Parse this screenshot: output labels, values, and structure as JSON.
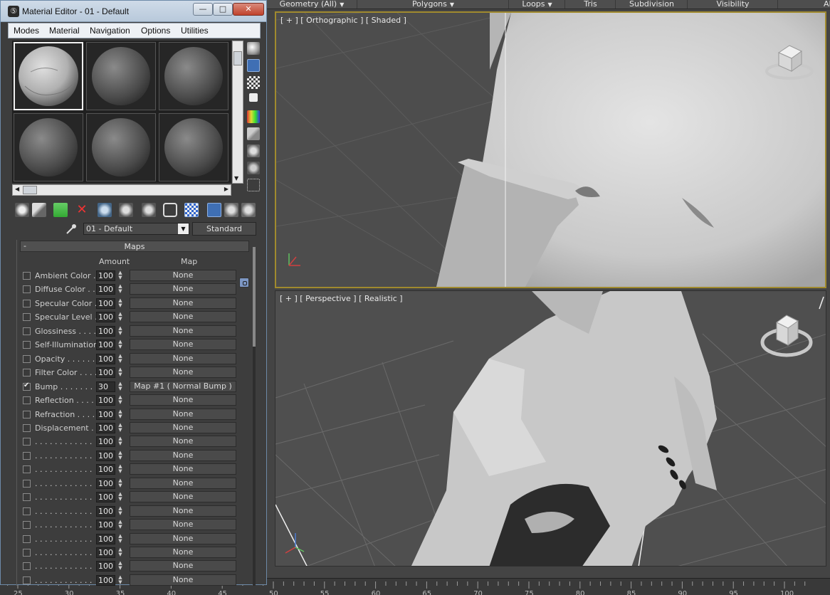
{
  "ribbon": {
    "items": [
      "Geometry (All)",
      "Polygons",
      "Loops",
      "Tris",
      "Subdivision",
      "Visibility",
      "Alig"
    ]
  },
  "viewport_top": {
    "label": "[ + ] [ Orthographic ] [ Shaded ]"
  },
  "viewport_bottom": {
    "label": "[ + ] [ Perspective ] [ Realistic ]"
  },
  "ruler": {
    "ticks": [
      "25",
      "30",
      "35",
      "40",
      "45",
      "50",
      "55",
      "60",
      "65",
      "70",
      "75",
      "80",
      "85",
      "90",
      "95",
      "100"
    ]
  },
  "material_editor": {
    "title": "Material Editor - 01 - Default",
    "window_buttons": {
      "minimize": "—",
      "maximize": "□",
      "close": "✕"
    },
    "menu": [
      "Modes",
      "Material",
      "Navigation",
      "Options",
      "Utilities"
    ],
    "material_name": "01 - Default",
    "material_type": "Standard",
    "rollout": {
      "collapse": "-",
      "title": "Maps",
      "col_amount": "Amount",
      "col_map": "Map"
    },
    "maps": [
      {
        "label": "Ambient Color . .",
        "amount": "100",
        "map": "None",
        "checked": false
      },
      {
        "label": "Diffuse Color . . .",
        "amount": "100",
        "map": "None",
        "checked": false
      },
      {
        "label": "Specular Color  .",
        "amount": "100",
        "map": "None",
        "checked": false
      },
      {
        "label": "Specular Level  .",
        "amount": "100",
        "map": "None",
        "checked": false
      },
      {
        "label": "Glossiness  . . . .",
        "amount": "100",
        "map": "None",
        "checked": false
      },
      {
        "label": "Self-Illumination .",
        "amount": "100",
        "map": "None",
        "checked": false
      },
      {
        "label": "Opacity . . . . . .",
        "amount": "100",
        "map": "None",
        "checked": false
      },
      {
        "label": "Filter Color  . . . .",
        "amount": "100",
        "map": "None",
        "checked": false
      },
      {
        "label": "Bump  . . . . . . .",
        "amount": "30",
        "map": "Map #1  ( Normal Bump )",
        "checked": true
      },
      {
        "label": "Reflection  . . . .",
        "amount": "100",
        "map": "None",
        "checked": false
      },
      {
        "label": "Refraction  . . . .",
        "amount": "100",
        "map": "None",
        "checked": false
      },
      {
        "label": "Displacement  . .",
        "amount": "100",
        "map": "None",
        "checked": false
      },
      {
        "label": ". . . . . . . . . . . .",
        "amount": "100",
        "map": "None",
        "checked": false
      },
      {
        "label": ". . . . . . . . . . . .",
        "amount": "100",
        "map": "None",
        "checked": false
      },
      {
        "label": ". . . . . . . . . . . .",
        "amount": "100",
        "map": "None",
        "checked": false
      },
      {
        "label": ". . . . . . . . . . . .",
        "amount": "100",
        "map": "None",
        "checked": false
      },
      {
        "label": ". . . . . . . . . . . .",
        "amount": "100",
        "map": "None",
        "checked": false
      },
      {
        "label": ". . . . . . . . . . . .",
        "amount": "100",
        "map": "None",
        "checked": false
      },
      {
        "label": ". . . . . . . . . . . .",
        "amount": "100",
        "map": "None",
        "checked": false
      },
      {
        "label": ". . . . . . . . . . . .",
        "amount": "100",
        "map": "None",
        "checked": false
      },
      {
        "label": ". . . . . . . . . . . .",
        "amount": "100",
        "map": "None",
        "checked": false
      },
      {
        "label": ". . . . . . . . . . . .",
        "amount": "100",
        "map": "None",
        "checked": false
      },
      {
        "label": ". . . . . . . . . . . .",
        "amount": "100",
        "map": "None",
        "checked": false
      }
    ]
  },
  "colors": {
    "active_viewport_border": "#a08a2e",
    "title_bar": "#c7d5e4",
    "panel_bg": "#3d3d3d"
  }
}
